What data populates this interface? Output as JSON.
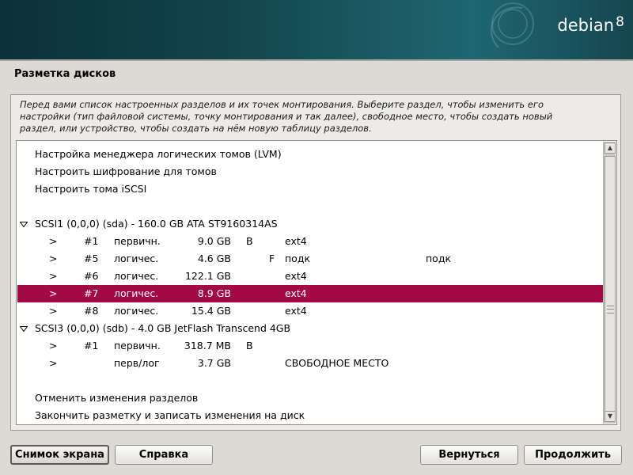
{
  "branding": {
    "name": "debian",
    "version": "8"
  },
  "page_title": "Разметка дисков",
  "help_lines": [
    "Перед вами список настроенных разделов и их точек монтирования. Выберите раздел, чтобы изменить его",
    "настройки (тип файловой системы, точку монтирования и так далее), свободное место, чтобы создать новый",
    "раздел, или устройство, чтобы создать на нём новую таблицу разделов."
  ],
  "partition_list": {
    "rows": [
      {
        "name": "action-lvm",
        "label": "Настройка менеджера логических томов (LVM)"
      },
      {
        "name": "action-encryption",
        "label": "Настроить шифрование для томов"
      },
      {
        "name": "action-iscsi",
        "label": "Настроить тома iSCSI"
      },
      {
        "name": "device-sda",
        "label": "SCSI1 (0,0,0) (sda) - 160.0 GB ATA ST9160314AS"
      },
      {
        "name": "partition-sda-1",
        "arrow": ">",
        "num": "#1",
        "type": "первичн.",
        "size": "9.0 GB",
        "flag1": "B",
        "flag2": "",
        "fs": "ext4",
        "mount": ""
      },
      {
        "name": "partition-sda-5",
        "arrow": ">",
        "num": "#5",
        "type": "логичес.",
        "size": "4.6 GB",
        "flag1": "",
        "flag2": "F",
        "fs": "подк",
        "mount": "подк"
      },
      {
        "name": "partition-sda-6",
        "arrow": ">",
        "num": "#6",
        "type": "логичес.",
        "size": "122.1 GB",
        "flag1": "",
        "flag2": "",
        "fs": "ext4",
        "mount": ""
      },
      {
        "name": "partition-sda-7",
        "arrow": ">",
        "num": "#7",
        "type": "логичес.",
        "size": "8.9 GB",
        "flag1": "",
        "flag2": "",
        "fs": "ext4",
        "mount": "",
        "selected": true
      },
      {
        "name": "partition-sda-8",
        "arrow": ">",
        "num": "#8",
        "type": "логичес.",
        "size": "15.4 GB",
        "flag1": "",
        "flag2": "",
        "fs": "ext4",
        "mount": ""
      },
      {
        "name": "device-sdb",
        "label": "SCSI3 (0,0,0) (sdb) - 4.0 GB JetFlash Transcend 4GB"
      },
      {
        "name": "partition-sdb-1",
        "arrow": ">",
        "num": "#1",
        "type": "первичн.",
        "size": "318.7 MB",
        "flag1": "B",
        "flag2": "",
        "fs": "",
        "mount": ""
      },
      {
        "name": "partition-sdb-free",
        "arrow": ">",
        "num": "",
        "type": "перв/лог",
        "size": "3.7 GB",
        "flag1": "",
        "flag2": "",
        "fs": "СВОБОДНОЕ МЕСТО",
        "mount": ""
      },
      {
        "name": "action-undo",
        "label": "Отменить изменения разделов"
      },
      {
        "name": "action-finish",
        "label": "Закончить разметку и записать изменения на диск"
      }
    ]
  },
  "buttons": {
    "screenshot": "Снимок экрана",
    "help": "Справка",
    "back": "Вернуться",
    "continue": "Продолжить"
  },
  "colors": {
    "selection": "#a20a45",
    "banner": "#12434b"
  }
}
